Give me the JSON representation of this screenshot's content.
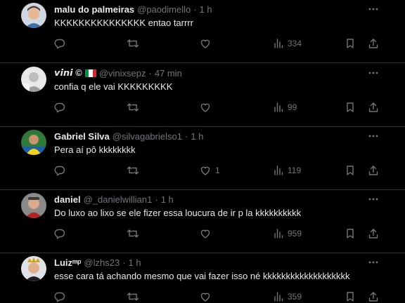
{
  "colors": {
    "background": "#000000",
    "text_primary": "#e7e9ea",
    "text_secondary": "#71767b",
    "divider": "#2f3336"
  },
  "icons": {
    "more": "more-horizontal-icon",
    "reply": "reply-icon",
    "retweet": "retweet-icon",
    "like": "heart-icon",
    "views": "views-bar-chart-icon",
    "bookmark": "bookmark-icon",
    "share": "share-icon"
  },
  "tweets": [
    {
      "name": "malu do palmeiras",
      "handle": "@paodimello",
      "dot": "·",
      "time": "1 h",
      "text": "KKKKKKKKKKKKKKK entao tarrrr",
      "likes": "",
      "views": "334"
    },
    {
      "name": "𝙫𝙞𝙣𝙞 ©",
      "handle": "@vinixsepz",
      "dot": "·",
      "time": "47 min",
      "text": "confia q ele vai KKKKKKKKK",
      "likes": "",
      "views": "99"
    },
    {
      "name": "Gabriel Silva",
      "handle": "@silvagabrielso1",
      "dot": "·",
      "time": "1 h",
      "text": "Pera aí pô kkkkkkkk",
      "likes": "1",
      "views": "119"
    },
    {
      "name": "daniel",
      "handle": "@_danielwillian1",
      "dot": "·",
      "time": "1 h",
      "text": "Do luxo ao lixo se ele fizer essa loucura de ir p la kkkkkkkkkk",
      "likes": "",
      "views": "959"
    },
    {
      "name": "Luizᵐᵖ",
      "handle": "@lzhs23",
      "dot": "·",
      "time": "1 h",
      "text": "esse cara tá achando mesmo que vai fazer isso né kkkkkkkkkkkkkkkkkkk",
      "likes": "",
      "views": "359"
    }
  ]
}
